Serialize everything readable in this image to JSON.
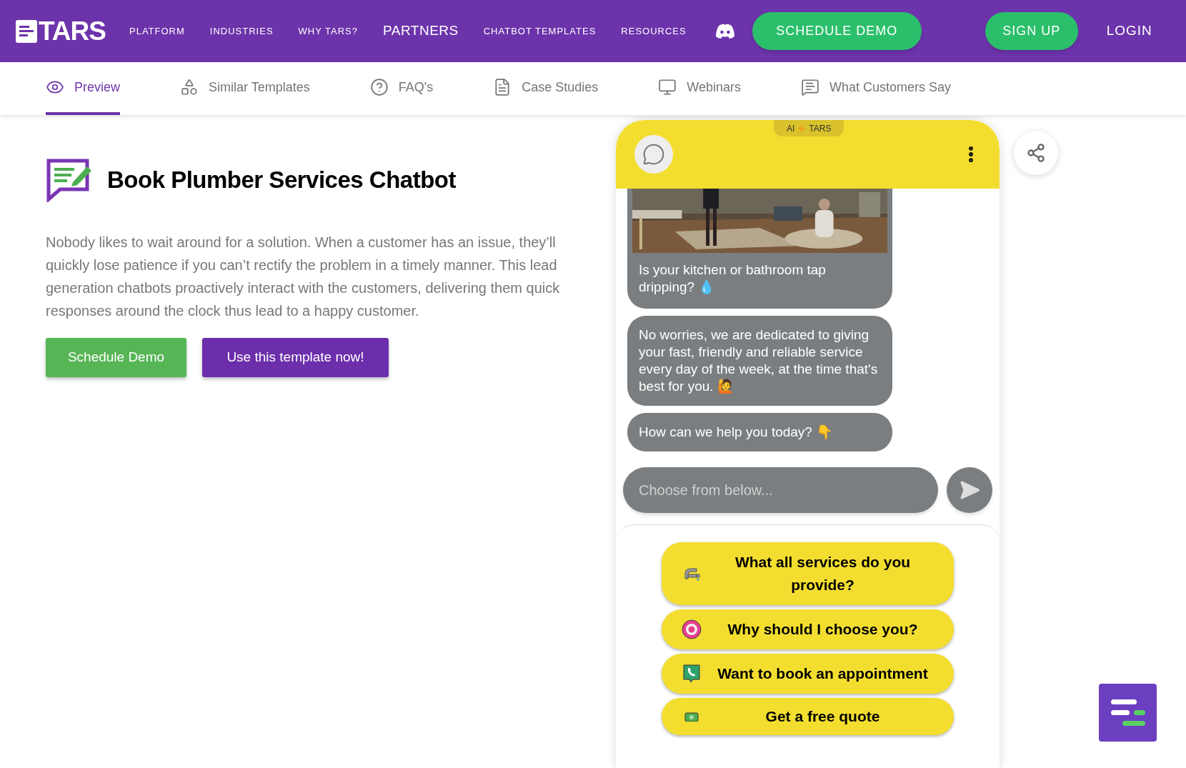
{
  "brand": {
    "name": "TARS"
  },
  "nav": {
    "links": [
      {
        "label": "PLATFORM",
        "kind": "small"
      },
      {
        "label": "INDUSTRIES",
        "kind": "small"
      },
      {
        "label": "WHY TARS?",
        "kind": "small"
      },
      {
        "label": "PARTNERS",
        "kind": "large"
      },
      {
        "label": "CHATBOT TEMPLATES",
        "kind": "small"
      },
      {
        "label": "RESOURCES",
        "kind": "small"
      }
    ],
    "schedule_demo": "SCHEDULE DEMO",
    "sign_up": "SIGN UP",
    "login": "LOGIN"
  },
  "tabs": [
    {
      "label": "Preview",
      "kind": "eye",
      "selected": true
    },
    {
      "label": "Similar Templates",
      "kind": "shapes",
      "selected": false
    },
    {
      "label": "FAQ's",
      "kind": "question",
      "selected": false
    },
    {
      "label": "Case Studies",
      "kind": "document",
      "selected": false
    },
    {
      "label": "Webinars",
      "kind": "monitor",
      "selected": false
    },
    {
      "label": "What Customers Say",
      "kind": "review",
      "selected": false
    }
  ],
  "template": {
    "title": "Book Plumber Services Chatbot",
    "description": "Nobody likes to wait around for a solution. When a customer has an issue, they’ll quickly lose patience if you can’t rectify the problem in a timely manner. This lead generation chatbots proactively interact with the customers, delivering them quick responses around the clock thus lead to a happy customer.",
    "buttons": [
      {
        "label": "Schedule Demo",
        "kind": "green"
      },
      {
        "label": "Use this template now!",
        "kind": "purple"
      }
    ]
  },
  "chat": {
    "badge": {
      "left": "AI",
      "right": "TARS"
    },
    "messages": [
      {
        "kind": "picture",
        "text": "Is your kitchen or bathroom tap dripping? 💧"
      },
      {
        "kind": "text",
        "text": "No worries, we are dedicated to giving your fast, friendly and reliable service every day of the week, at the time that's best for you. 🙋"
      },
      {
        "kind": "text",
        "text": "How can we help you today? 👇"
      }
    ],
    "input": {
      "placeholder": "Choose from below..."
    },
    "options": [
      {
        "label": "What all services do you provide?",
        "kind": "faucet"
      },
      {
        "label": "Why should I choose you?",
        "kind": "target"
      },
      {
        "label": "Want to book an appointment",
        "kind": "phone"
      },
      {
        "label": "Get a free quote",
        "kind": "money"
      }
    ]
  }
}
